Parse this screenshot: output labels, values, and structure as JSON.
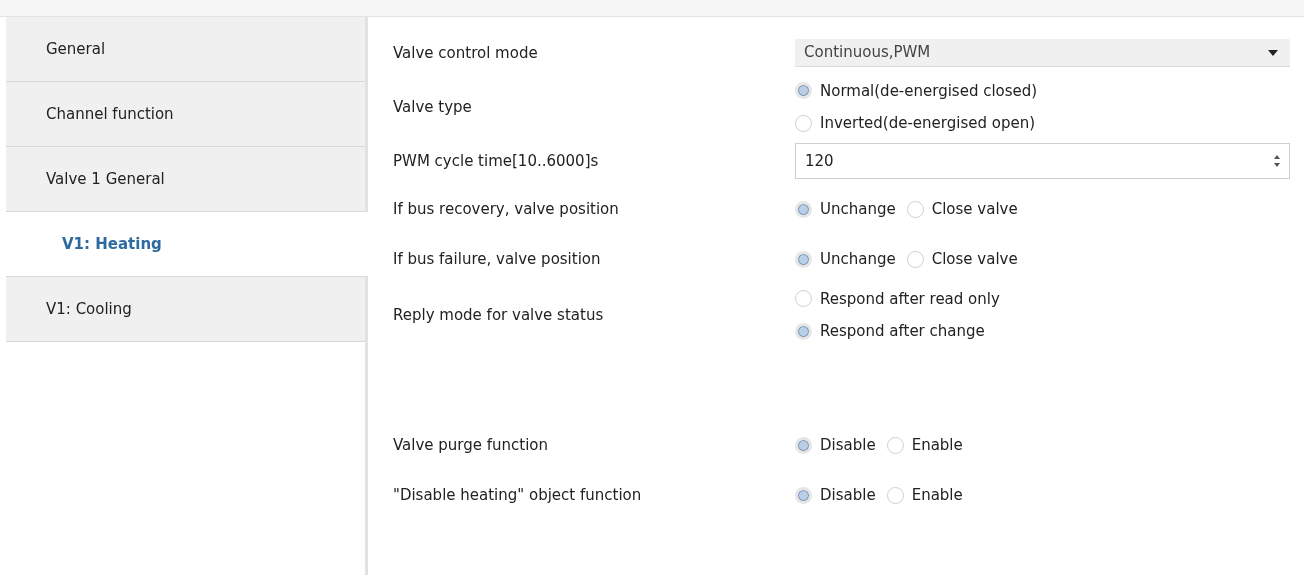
{
  "sidebar": {
    "items": [
      {
        "label": "General",
        "selected": false
      },
      {
        "label": "Channel function",
        "selected": false
      },
      {
        "label": "Valve 1 General",
        "selected": false
      },
      {
        "label": "V1: Heating",
        "selected": true
      },
      {
        "label": "V1: Cooling",
        "selected": false
      }
    ]
  },
  "parameters": [
    {
      "kind": "dropdown",
      "label": "Valve control mode",
      "value": "Continuous,PWM"
    },
    {
      "kind": "radio",
      "label": "Valve type",
      "vertical": true,
      "options": [
        {
          "label": "Normal(de-energised closed)",
          "selected": true
        },
        {
          "label": "Inverted(de-energised open)",
          "selected": false
        }
      ]
    },
    {
      "kind": "spin",
      "label": "PWM cycle time[10..6000]s",
      "value": "120"
    },
    {
      "kind": "radio",
      "label": "If bus recovery, valve position",
      "vertical": false,
      "options": [
        {
          "label": "Unchange",
          "selected": true
        },
        {
          "label": "Close valve",
          "selected": false
        }
      ]
    },
    {
      "kind": "radio",
      "label": "If bus failure, valve position",
      "vertical": false,
      "options": [
        {
          "label": "Unchange",
          "selected": true
        },
        {
          "label": "Close valve",
          "selected": false
        }
      ]
    },
    {
      "kind": "radio",
      "label": "Reply mode for valve status",
      "vertical": true,
      "options": [
        {
          "label": "Respond after read only",
          "selected": false
        },
        {
          "label": "Respond after change",
          "selected": true
        }
      ]
    },
    {
      "kind": "blank"
    },
    {
      "kind": "radio",
      "label": "Valve purge function",
      "vertical": false,
      "options": [
        {
          "label": "Disable",
          "selected": true
        },
        {
          "label": "Enable",
          "selected": false
        }
      ]
    },
    {
      "kind": "radio",
      "label": "\"Disable heating\" object function",
      "vertical": false,
      "options": [
        {
          "label": "Disable",
          "selected": true
        },
        {
          "label": "Enable",
          "selected": false
        }
      ]
    }
  ]
}
